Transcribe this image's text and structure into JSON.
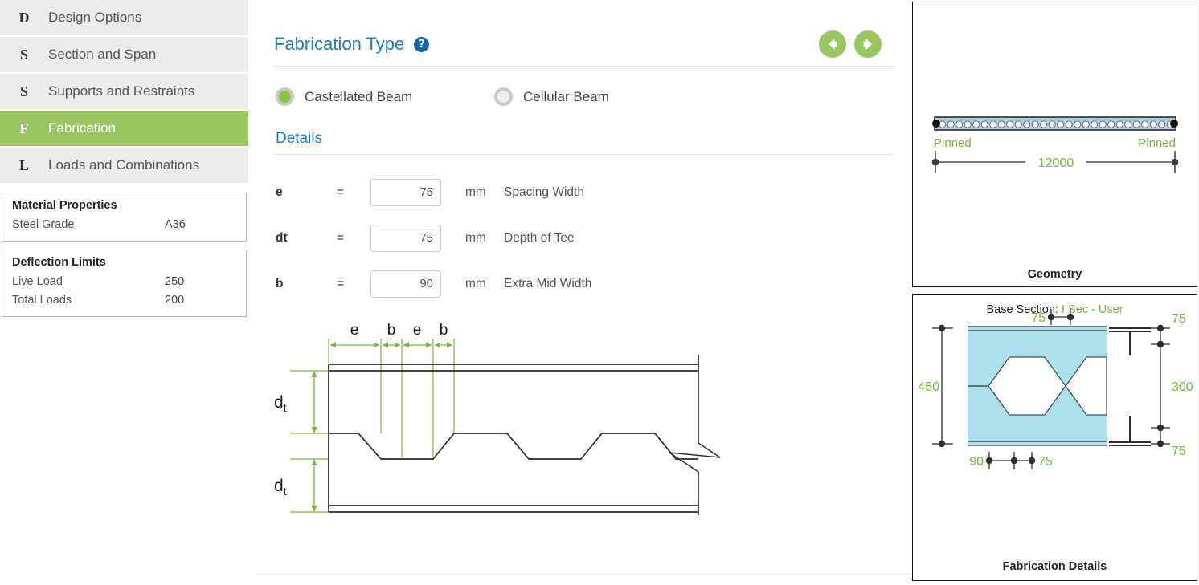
{
  "sidebar": {
    "nav_items": [
      {
        "badge": "D",
        "label": "Design Options",
        "active": false
      },
      {
        "badge": "S",
        "label": "Section and Span",
        "active": false
      },
      {
        "badge": "S",
        "label": "Supports and Restraints",
        "active": false
      },
      {
        "badge": "F",
        "label": "Fabrication",
        "active": true
      },
      {
        "badge": "L",
        "label": "Loads and Combinations",
        "active": false
      }
    ],
    "material_properties": {
      "title": "Material Properties",
      "rows": [
        {
          "key": "Steel Grade",
          "value": "A36"
        }
      ]
    },
    "deflection_limits": {
      "title": "Deflection Limits",
      "rows": [
        {
          "key": "Live Load",
          "value": "250"
        },
        {
          "key": "Total Loads",
          "value": "200"
        }
      ]
    }
  },
  "main": {
    "section_title": "Fabrication Type",
    "help_icon": "help-icon",
    "prev_icon": "arrow-left-icon",
    "next_icon": "arrow-right-icon",
    "fabrication_type": {
      "options": [
        {
          "label": "Castellated Beam",
          "selected": true
        },
        {
          "label": "Cellular Beam",
          "selected": false
        }
      ]
    },
    "details_title": "Details",
    "fields": [
      {
        "symbol": "e",
        "eq": "=",
        "value": "75",
        "unit": "mm",
        "description": "Spacing Width"
      },
      {
        "symbol": "dt",
        "eq": "=",
        "value": "75",
        "unit": "mm",
        "description": "Depth of Tee"
      },
      {
        "symbol": "b",
        "eq": "=",
        "value": "90",
        "unit": "mm",
        "description": "Extra Mid Width"
      }
    ],
    "diagram": {
      "top_labels": [
        "e",
        "b",
        "e",
        "b"
      ],
      "vertical_labels": [
        "dt",
        "dt"
      ]
    }
  },
  "geometry_panel": {
    "caption": "Geometry",
    "left_support": "Pinned",
    "right_support": "Pinned",
    "span": "12000"
  },
  "fabrication_panel": {
    "caption": "Fabrication Details",
    "base_section_label": "Base Section:",
    "base_section_value": "I Sec - User",
    "dim_left": "450",
    "dim_right": "300",
    "dim_top": "75",
    "dim_right_top": "75",
    "dim_right_bottom": "75",
    "dim_bottom_left": "90",
    "dim_bottom_right": "75"
  },
  "colors": {
    "accent_green": "#9ac662",
    "title_blue": "#1f7cc4",
    "help_blue": "#1565a8",
    "dim_green": "#7cb342",
    "web_fill": "#ade0ec",
    "nav_bg": "#ececec"
  }
}
